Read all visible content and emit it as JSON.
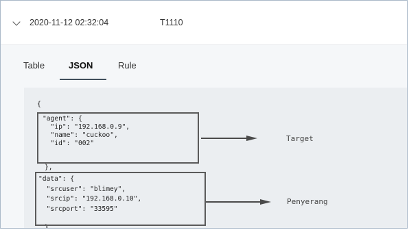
{
  "row": {
    "timestamp": "2020-11-12 02:32:04",
    "rule_id": "T1110"
  },
  "tabs": [
    {
      "label": "Table"
    },
    {
      "label": "JSON",
      "active": true
    },
    {
      "label": "Rule"
    }
  ],
  "json_lines": {
    "open": "{",
    "agent_open": "\"agent\": {",
    "ip": "  \"ip\": \"192.168.0.9\",",
    "name": "  \"name\": \"cuckoo\",",
    "id": "  \"id\": \"002\"",
    "agent_close": "},",
    "data_open": "\"data\": {",
    "srcuser": "  \"srcuser\": \"blimey\",",
    "srcip": "  \"srcip\": \"192.168.0.10\",",
    "srcport": "  \"srcport\": \"33595\"",
    "data_close": "},"
  },
  "annotations": {
    "target": "Target",
    "attacker": "Penyerang"
  },
  "colors": {
    "accent": "#404e5b",
    "panel": "#f5f7f9",
    "code_bg": "#ebeef1"
  },
  "icons": {
    "expand": "chevron-down-icon"
  }
}
